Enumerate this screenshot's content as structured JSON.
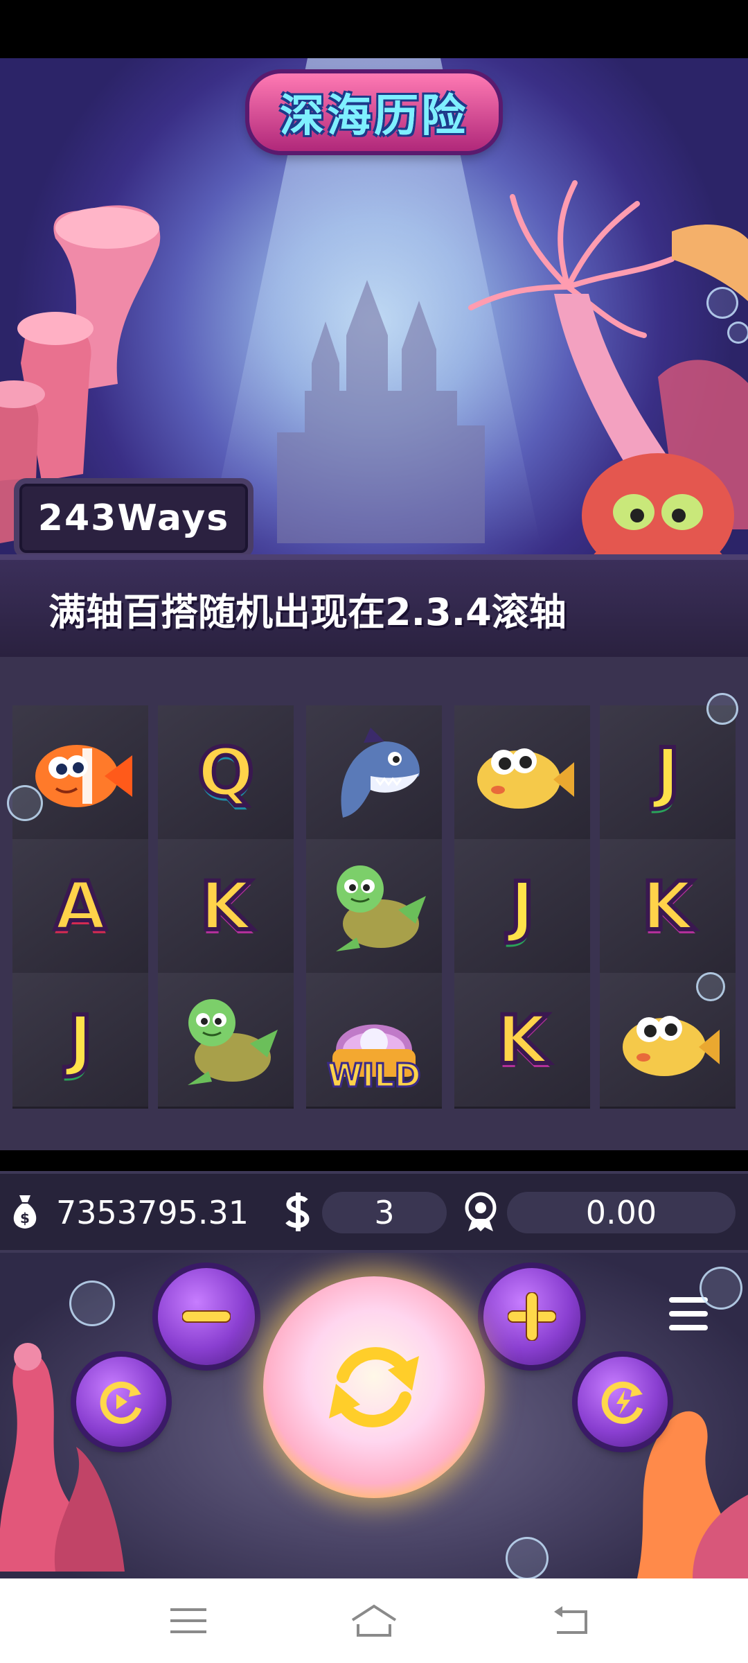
{
  "game": {
    "title": "深海历险",
    "ways_label": "243Ways",
    "banner_text": "满轴百搭随机出现在2.3.4滚轴"
  },
  "reels": [
    [
      {
        "symbol": "clownfish-icon",
        "label": ""
      },
      {
        "symbol": "A",
        "label": "A"
      },
      {
        "symbol": "J",
        "label": "J"
      }
    ],
    [
      {
        "symbol": "Q",
        "label": "Q"
      },
      {
        "symbol": "K",
        "label": "K"
      },
      {
        "symbol": "turtle-icon",
        "label": ""
      }
    ],
    [
      {
        "symbol": "shark-icon",
        "label": ""
      },
      {
        "symbol": "turtle-icon",
        "label": ""
      },
      {
        "symbol": "wild-icon",
        "label": "WILD"
      }
    ],
    [
      {
        "symbol": "pufferfish-icon",
        "label": ""
      },
      {
        "symbol": "J",
        "label": "J"
      },
      {
        "symbol": "K",
        "label": "K"
      }
    ],
    [
      {
        "symbol": "J",
        "label": "J"
      },
      {
        "symbol": "K",
        "label": "K"
      },
      {
        "symbol": "pufferfish-icon",
        "label": ""
      }
    ]
  ],
  "info_bar": {
    "balance": "7353795.31",
    "bet": "3",
    "win": "0.00"
  },
  "colors": {
    "accent_purple": "#8a3fd1",
    "gold": "#ffd34a",
    "panel": "#27233a"
  }
}
